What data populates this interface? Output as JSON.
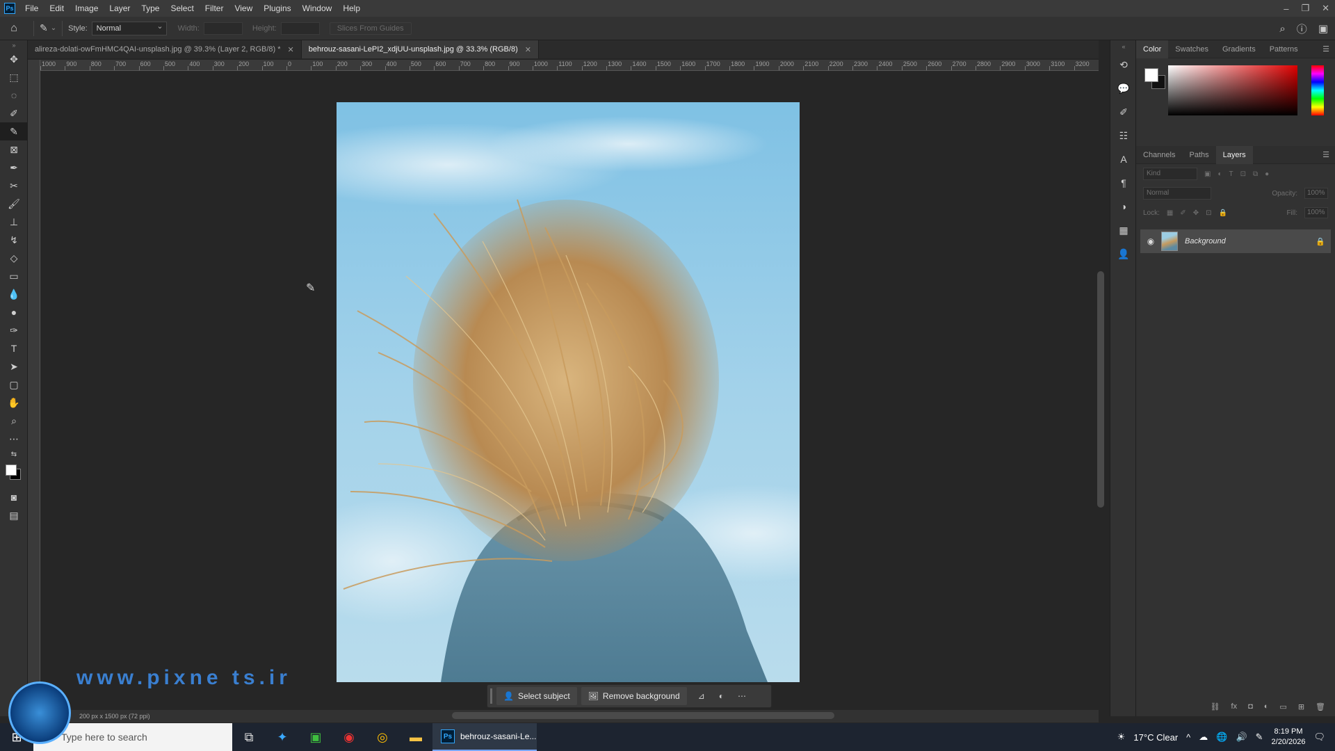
{
  "menubar": {
    "items": [
      "File",
      "Edit",
      "Image",
      "Layer",
      "Type",
      "Select",
      "Filter",
      "View",
      "Plugins",
      "Window",
      "Help"
    ]
  },
  "options": {
    "style_label": "Style:",
    "style_value": "Normal",
    "width_label": "Width:",
    "height_label": "Height:",
    "slices_button": "Slices From Guides"
  },
  "tabs": [
    {
      "label": "alireza-dolati-owFmHMC4QAI-unsplash.jpg @ 39.3% (Layer 2, RGB/8) *",
      "active": false
    },
    {
      "label": "behrouz-sasani-LePI2_xdjUU-unsplash.jpg @ 33.3% (RGB/8)",
      "active": true
    }
  ],
  "ruler_top": [
    "1000",
    "900",
    "800",
    "700",
    "600",
    "500",
    "400",
    "300",
    "200",
    "100",
    "0",
    "100",
    "200",
    "300",
    "400",
    "500",
    "600",
    "700",
    "800",
    "900",
    "1000",
    "1100",
    "1200",
    "1300",
    "1400",
    "1500",
    "1600",
    "1700",
    "1800",
    "1900",
    "2000",
    "2100",
    "2200",
    "2300",
    "2400",
    "2500",
    "2600",
    "2700",
    "2800",
    "2900",
    "3000",
    "3100",
    "3200"
  ],
  "contextual_bar": {
    "select_subject": "Select subject",
    "remove_background": "Remove background"
  },
  "status": {
    "doc_info": "200 px x 1500 px (72 ppi)"
  },
  "panels": {
    "color_tabs": [
      "Color",
      "Swatches",
      "Gradients",
      "Patterns"
    ],
    "layer_tabs": [
      "Channels",
      "Paths",
      "Layers"
    ],
    "kind_placeholder": "Kind",
    "blend_mode": "Normal",
    "opacity_label": "Opacity:",
    "opacity_value": "100%",
    "lock_label": "Lock:",
    "fill_label": "Fill:",
    "fill_value": "100%",
    "layer_name": "Background"
  },
  "taskbar": {
    "search_placeholder": "Type here to search",
    "ps_window": "behrouz-sasani-Le...",
    "weather": "17°C  Clear",
    "time": "8:19 PM",
    "date": "2/20/2026"
  },
  "watermark": {
    "text": "www.pixne ts.ir"
  },
  "colors": {
    "accent": "#31a8ff",
    "sky": "#9ccde3",
    "sweater": "#5d8aa1",
    "hair": "#c59a5e"
  }
}
